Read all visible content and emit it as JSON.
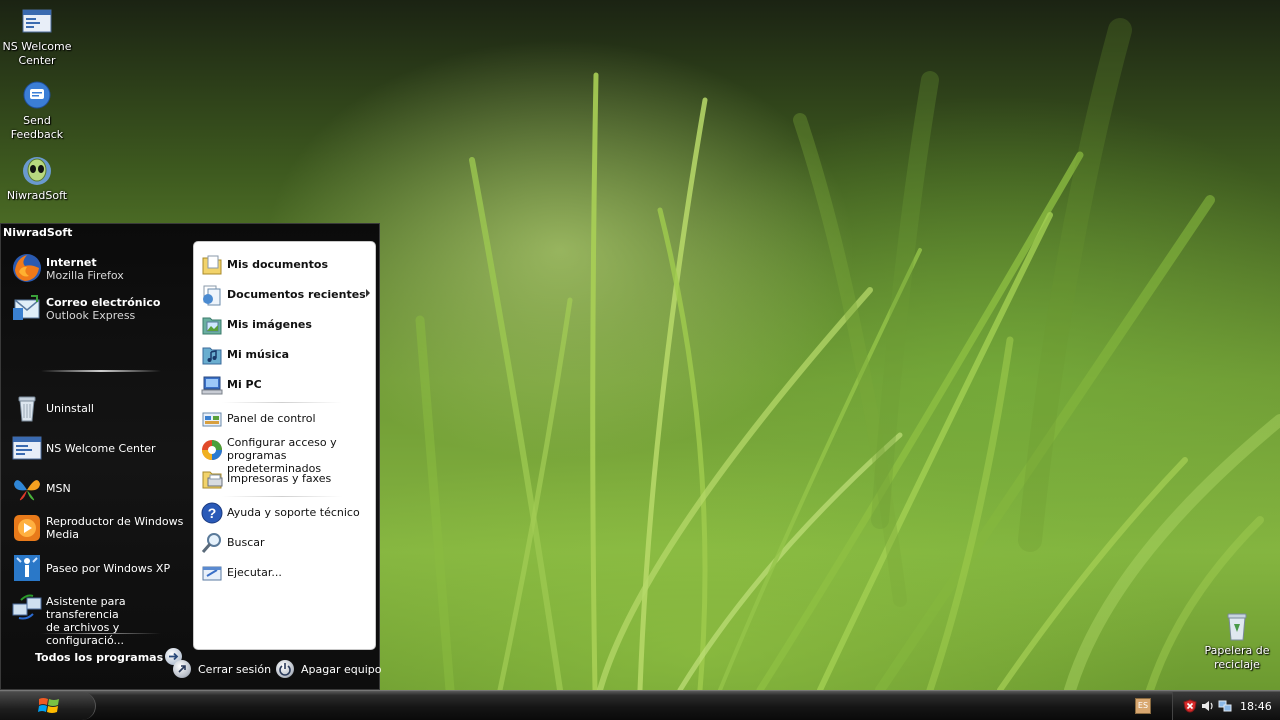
{
  "desktop": {
    "icons": [
      {
        "label_line1": "NS Welcome",
        "label_line2": "Center",
        "icon": "welcome-center-icon"
      },
      {
        "label_line1": "Send",
        "label_line2": "Feedback",
        "icon": "feedback-icon"
      },
      {
        "label_line1": "NiwradSoft",
        "label_line2": "",
        "icon": "alien-icon"
      },
      {
        "label_line1": "Papelera de",
        "label_line2": "reciclaje",
        "icon": "recycle-bin-icon"
      }
    ]
  },
  "start_menu": {
    "user_name": "NiwradSoft",
    "pinned": [
      {
        "title": "Internet",
        "subtitle": "Mozilla Firefox",
        "icon": "firefox-icon"
      },
      {
        "title": "Correo electrónico",
        "subtitle": "Outlook Express",
        "icon": "outlook-express-icon"
      }
    ],
    "recent": [
      {
        "line1": "Uninstall",
        "line2": "",
        "icon": "uninstall-icon"
      },
      {
        "line1": "NS Welcome Center",
        "line2": "",
        "icon": "welcome-center-icon"
      },
      {
        "line1": "MSN",
        "line2": "",
        "icon": "msn-butterfly-icon"
      },
      {
        "line1": "Reproductor de Windows",
        "line2": "Media",
        "icon": "media-player-icon"
      },
      {
        "line1": "Paseo por Windows XP",
        "line2": "",
        "icon": "tour-icon"
      },
      {
        "line1": "Asistente para transferencia",
        "line2": "de archivos y configuració...",
        "icon": "transfer-wizard-icon"
      }
    ],
    "all_programs_label": "Todos los programas",
    "places": [
      {
        "line1": "Mis documentos",
        "line2": "",
        "icon": "my-documents-icon",
        "bold": true
      },
      {
        "line1": "Documentos recientes",
        "line2": "",
        "icon": "recent-documents-icon",
        "bold": true,
        "submenu": true
      },
      {
        "line1": "Mis imágenes",
        "line2": "",
        "icon": "my-pictures-icon",
        "bold": true
      },
      {
        "line1": "Mi música",
        "line2": "",
        "icon": "my-music-icon",
        "bold": true
      },
      {
        "line1": "Mi PC",
        "line2": "",
        "icon": "my-computer-icon",
        "bold": true
      },
      {
        "line1": "Panel de control",
        "line2": "",
        "icon": "control-panel-icon",
        "bold": false
      },
      {
        "line1": "Configurar acceso y",
        "line2": "programas predeterminados",
        "icon": "program-access-icon",
        "bold": false
      },
      {
        "line1": "Impresoras y faxes",
        "line2": "",
        "icon": "printers-icon",
        "bold": false
      },
      {
        "line1": "Ayuda y soporte técnico",
        "line2": "",
        "icon": "help-icon",
        "bold": false
      },
      {
        "line1": "Buscar",
        "line2": "",
        "icon": "search-icon",
        "bold": false
      },
      {
        "line1": "Ejecutar...",
        "line2": "",
        "icon": "run-icon",
        "bold": false
      }
    ],
    "logoff_label": "Cerrar sesión",
    "shutdown_label": "Apagar equipo"
  },
  "taskbar": {
    "language": "ES",
    "clock": "18:46",
    "tray_icons": [
      "security-alert-icon",
      "volume-icon",
      "network-icon"
    ]
  }
}
